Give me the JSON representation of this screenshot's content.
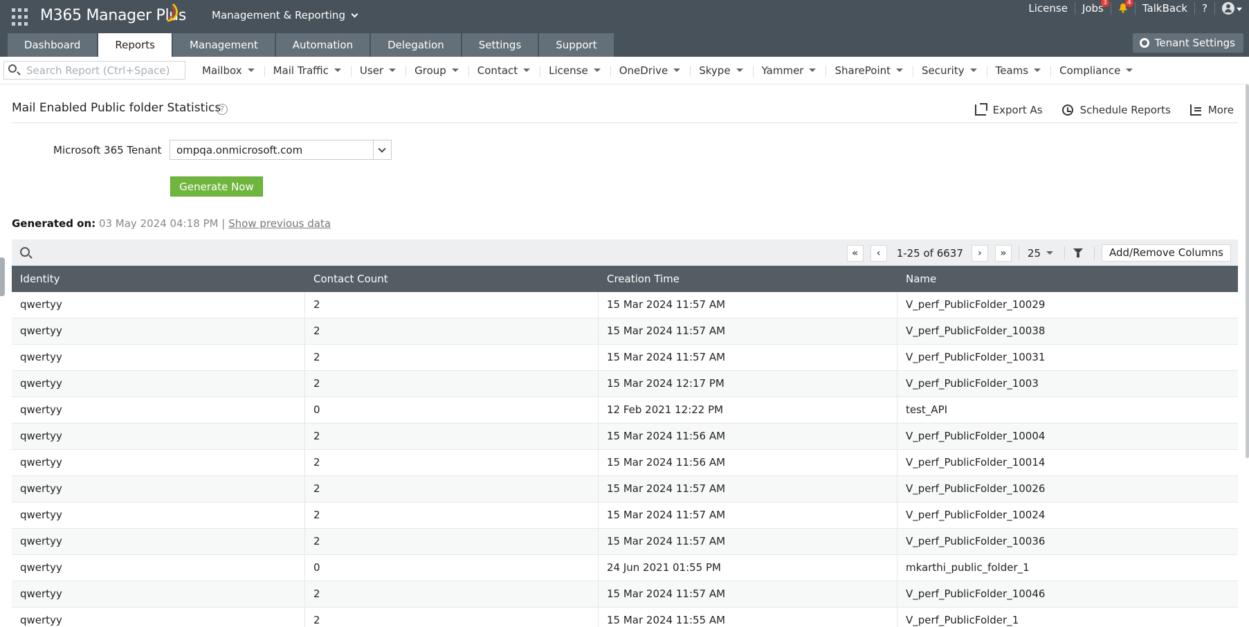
{
  "app": {
    "brand": "M365 Manager Plus",
    "module": "Management & Reporting"
  },
  "top_links": {
    "license": "License",
    "jobs": "Jobs",
    "jobs_badge": "3",
    "notifications_badge": "4",
    "talkback": "TalkBack",
    "help": "?"
  },
  "tabs": [
    {
      "label": "Dashboard",
      "active": false
    },
    {
      "label": "Reports",
      "active": true
    },
    {
      "label": "Management",
      "active": false
    },
    {
      "label": "Automation",
      "active": false
    },
    {
      "label": "Delegation",
      "active": false
    },
    {
      "label": "Settings",
      "active": false
    },
    {
      "label": "Support",
      "active": false
    }
  ],
  "tenant_settings": "Tenant Settings",
  "search": {
    "placeholder": "Search Report (Ctrl+Space)"
  },
  "menus": [
    "Mailbox",
    "Mail Traffic",
    "User",
    "Group",
    "Contact",
    "License",
    "OneDrive",
    "Skype",
    "Yammer",
    "SharePoint",
    "Security",
    "Teams",
    "Compliance"
  ],
  "page": {
    "title": "Mail Enabled Public folder Statistics",
    "help": "?",
    "actions": {
      "export": "Export As",
      "schedule": "Schedule Reports",
      "more": "More"
    },
    "tenant_label": "Microsoft 365 Tenant",
    "tenant_value": "ompqa.onmicrosoft.com",
    "generate": "Generate Now",
    "generated_label": "Generated on:",
    "generated_value": "03 May 2024 04:18 PM |",
    "show_previous": "Show previous data"
  },
  "pager": {
    "first": "«",
    "prev": "‹",
    "info": "1-25 of 6637",
    "next": "›",
    "last": "»",
    "page_size": "25",
    "add_remove": "Add/Remove Columns"
  },
  "table": {
    "columns": [
      "Identity",
      "Contact Count",
      "Creation Time",
      "Name"
    ],
    "rows": [
      [
        "qwertyy",
        "2",
        "15 Mar 2024 11:57 AM",
        "V_perf_PublicFolder_10029"
      ],
      [
        "qwertyy",
        "2",
        "15 Mar 2024 11:57 AM",
        "V_perf_PublicFolder_10038"
      ],
      [
        "qwertyy",
        "2",
        "15 Mar 2024 11:57 AM",
        "V_perf_PublicFolder_10031"
      ],
      [
        "qwertyy",
        "2",
        "15 Mar 2024 12:17 PM",
        "V_perf_PublicFolder_1003"
      ],
      [
        "qwertyy",
        "0",
        "12 Feb 2021 12:22 PM",
        "test_API"
      ],
      [
        "qwertyy",
        "2",
        "15 Mar 2024 11:56 AM",
        "V_perf_PublicFolder_10004"
      ],
      [
        "qwertyy",
        "2",
        "15 Mar 2024 11:56 AM",
        "V_perf_PublicFolder_10014"
      ],
      [
        "qwertyy",
        "2",
        "15 Mar 2024 11:57 AM",
        "V_perf_PublicFolder_10026"
      ],
      [
        "qwertyy",
        "2",
        "15 Mar 2024 11:57 AM",
        "V_perf_PublicFolder_10024"
      ],
      [
        "qwertyy",
        "2",
        "15 Mar 2024 11:57 AM",
        "V_perf_PublicFolder_10036"
      ],
      [
        "qwertyy",
        "0",
        "24 Jun 2021 01:55 PM",
        "mkarthi_public_folder_1"
      ],
      [
        "qwertyy",
        "2",
        "15 Mar 2024 11:57 AM",
        "V_perf_PublicFolder_10046"
      ],
      [
        "qwertyy",
        "2",
        "15 Mar 2024 11:55 AM",
        "V_perf_PublicFolder_1"
      ]
    ]
  },
  "colors": {
    "topbar": "#47525a",
    "tab": "#647079",
    "generate_button": "#6fb63f",
    "table_header": "#545d64",
    "badge": "#e53935"
  }
}
